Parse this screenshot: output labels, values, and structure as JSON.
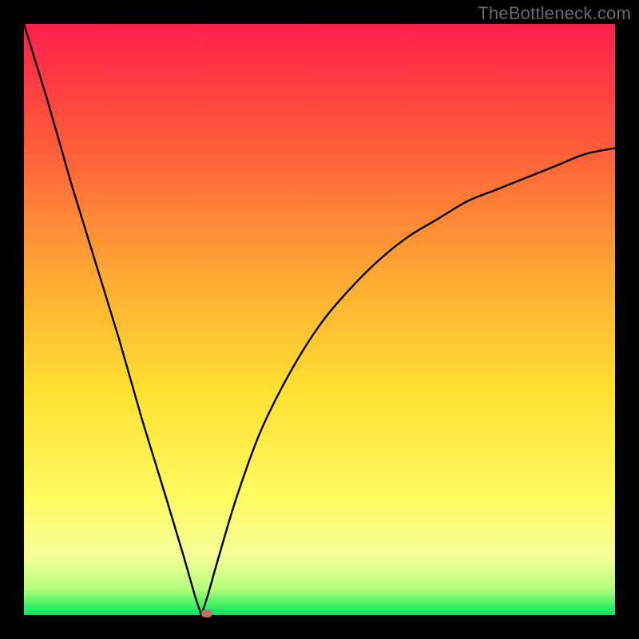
{
  "watermark": "TheBottleneck.com",
  "colors": {
    "frameBackground": "#000000",
    "watermarkText": "#6a6a6a",
    "curveStroke": "#000000",
    "markerFill": "#c37062",
    "gradientStops": [
      {
        "offset": 0.0,
        "color": "#ff1f4a"
      },
      {
        "offset": 0.2,
        "color": "#ff5a3a"
      },
      {
        "offset": 0.42,
        "color": "#ffa733"
      },
      {
        "offset": 0.62,
        "color": "#ffe031"
      },
      {
        "offset": 0.8,
        "color": "#fffb60"
      },
      {
        "offset": 0.9,
        "color": "#f6ff9a"
      },
      {
        "offset": 0.955,
        "color": "#b6ff7a"
      },
      {
        "offset": 1.0,
        "color": "#00e85d"
      }
    ]
  },
  "chart_data": {
    "type": "line",
    "title": "",
    "xlabel": "",
    "ylabel": "",
    "xlim": [
      0,
      100
    ],
    "ylim": [
      0,
      100
    ],
    "grid": false,
    "legend": false,
    "background": "rainbow-vertical-gradient",
    "note": "V-shaped bottleneck curve; minimum (value 0) occurs near x≈30. Left branch is near-linear steep descent from x=0; right branch curves asymptotically upward toward ~80. Values scaled 0–100 (percent of plot height).",
    "x": [
      0,
      4,
      8,
      12,
      16,
      20,
      24,
      27,
      29,
      30,
      31,
      33,
      36,
      40,
      45,
      50,
      55,
      60,
      65,
      70,
      75,
      80,
      85,
      90,
      95,
      100
    ],
    "values": [
      100,
      87,
      73,
      60,
      47,
      33,
      20,
      10,
      3,
      0,
      3,
      10,
      20,
      31,
      41,
      49,
      55,
      60,
      64,
      67,
      70,
      72,
      74,
      76,
      78,
      79
    ],
    "marker": {
      "x": 31,
      "y": 0,
      "shape": "rounded-rect",
      "color": "#c37062"
    }
  }
}
